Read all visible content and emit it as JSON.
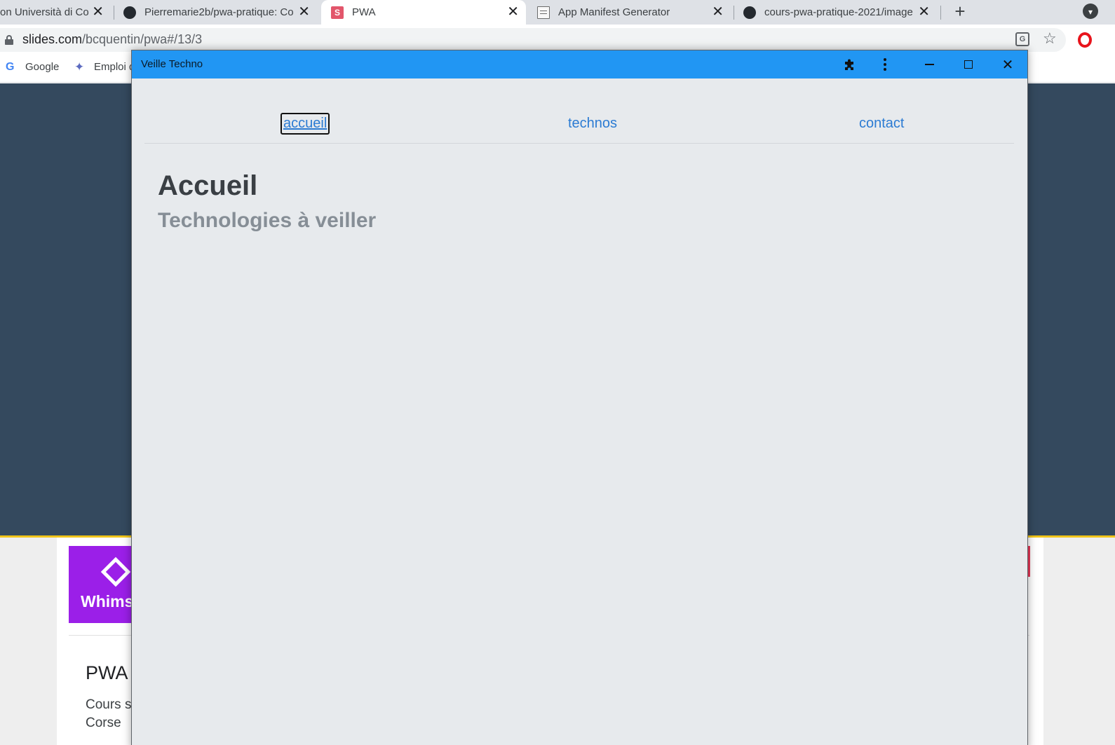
{
  "browser": {
    "tabs": [
      {
        "title": "on Università di Co",
        "favicon": "unknown-icon"
      },
      {
        "title": "Pierremarie2b/pwa-pratique: Co",
        "favicon": "github-icon"
      },
      {
        "title": "PWA",
        "favicon": "slides-icon",
        "favicon_letter": "S",
        "active": true
      },
      {
        "title": "App Manifest Generator",
        "favicon": "document-icon"
      },
      {
        "title": "cours-pwa-pratique-2021/image",
        "favicon": "github-icon"
      }
    ],
    "tab_close_glyph": "✕",
    "new_tab_glyph": "+",
    "url": {
      "domain": "slides.com",
      "path": "/bcquentin/pwa#/13/3"
    },
    "bookmarks": [
      {
        "label": "Google",
        "icon": "google-icon",
        "icon_glyph": "G"
      },
      {
        "label": "Emploi d",
        "icon": "emploi-icon",
        "icon_glyph": "✦"
      }
    ],
    "toolbar_icons": {
      "translate": "G",
      "star": "☆"
    }
  },
  "background_page": {
    "logo_text": "Whims",
    "card_title": "PWA",
    "card_desc_line1": "Cours s",
    "card_desc_line2": "Corse"
  },
  "pwa_window": {
    "title": "Veille Techno",
    "close_glyph": "✕",
    "nav": [
      {
        "label": "accueil",
        "focused": true
      },
      {
        "label": "technos"
      },
      {
        "label": "contact"
      }
    ],
    "heading": "Accueil",
    "subheading": "Technologies à veiller"
  },
  "colors": {
    "titlebar": "#2196f3",
    "app_background": "#e7eaed",
    "link": "#2b7bd3",
    "page_dark": "#34495e",
    "logo_purple": "#9b1fe8"
  }
}
